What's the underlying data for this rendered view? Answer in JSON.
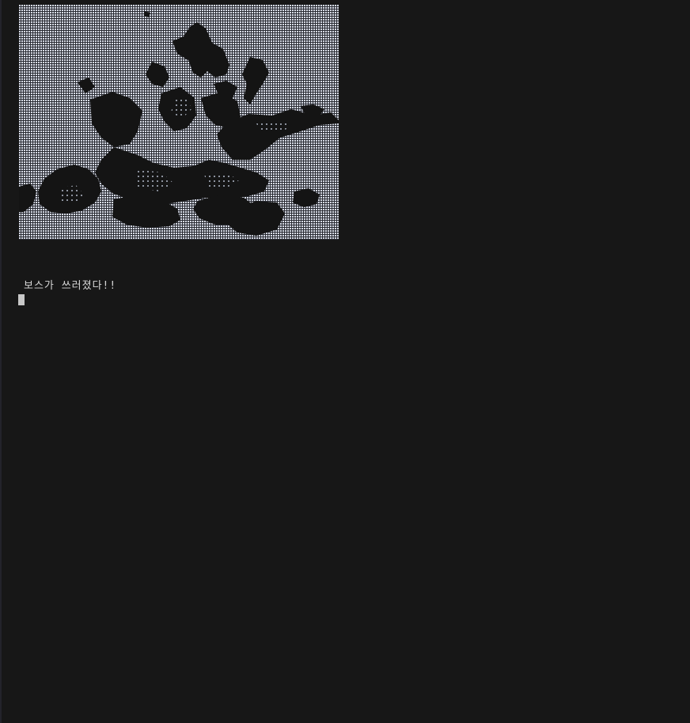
{
  "terminal": {
    "art": {
      "description_icon": "ascii-dot-art-image",
      "dot_color": "#d7dbe6",
      "background_color": "#161616",
      "shape_color": "#121212"
    },
    "message": "보스가 쓰러졌다!!",
    "colors": {
      "background": "#171717",
      "text": "#d8d8d8",
      "cursor": "#c8c8c8"
    }
  }
}
